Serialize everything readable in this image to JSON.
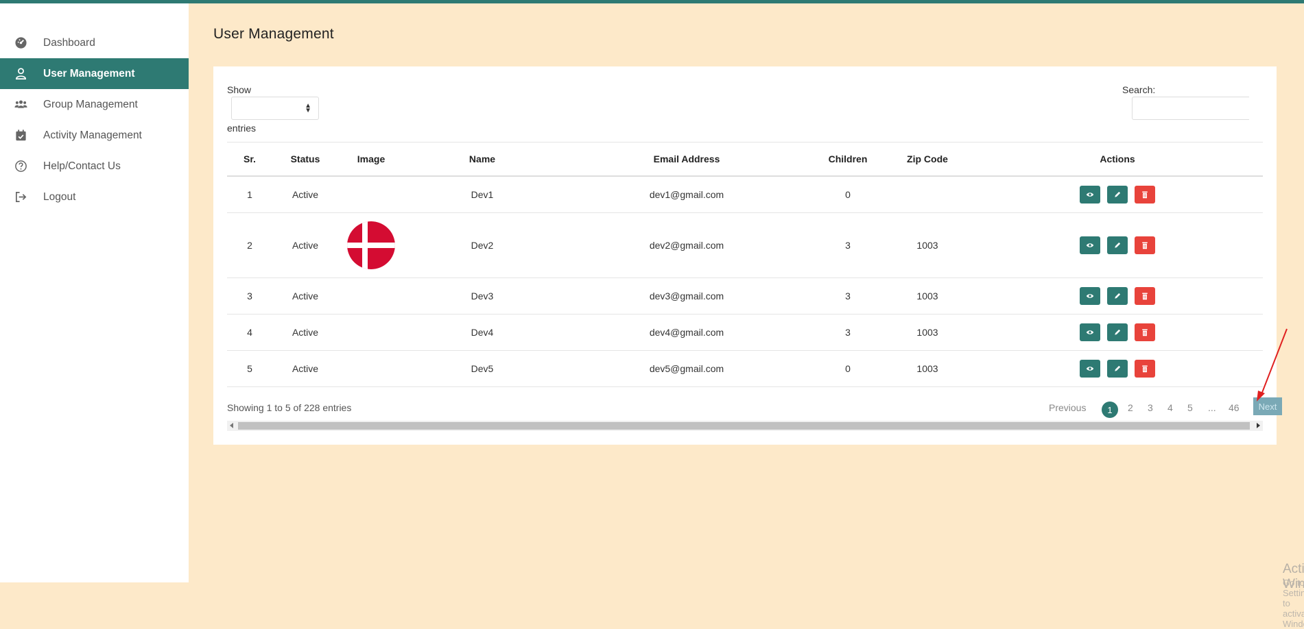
{
  "sidebar": {
    "items": [
      {
        "label": "Dashboard",
        "icon": "dashboard-icon",
        "active": false
      },
      {
        "label": "User Management",
        "icon": "user-icon",
        "active": true
      },
      {
        "label": "Group Management",
        "icon": "users-group-icon",
        "active": false
      },
      {
        "label": "Activity Management",
        "icon": "calendar-check-icon",
        "active": false
      },
      {
        "label": "Help/Contact Us",
        "icon": "help-circle-icon",
        "active": false
      },
      {
        "label": "Logout",
        "icon": "logout-icon",
        "active": false
      }
    ]
  },
  "page": {
    "title": "User Management"
  },
  "controls": {
    "show_label": "Show",
    "entries_label": "entries",
    "search_label": "Search:",
    "length_value": ""
  },
  "table": {
    "headers": [
      "Sr.",
      "Status",
      "Image",
      "Name",
      "Email Address",
      "Children",
      "Zip Code",
      "Actions"
    ],
    "rows": [
      {
        "sr": "1",
        "status": "Active",
        "image": "",
        "name": "Dev1",
        "email": "dev1@gmail.com",
        "children": "0",
        "zip": ""
      },
      {
        "sr": "2",
        "status": "Active",
        "image": "denmark-flag",
        "name": "Dev2",
        "email": "dev2@gmail.com",
        "children": "3",
        "zip": "1003"
      },
      {
        "sr": "3",
        "status": "Active",
        "image": "",
        "name": "Dev3",
        "email": "dev3@gmail.com",
        "children": "3",
        "zip": "1003"
      },
      {
        "sr": "4",
        "status": "Active",
        "image": "",
        "name": "Dev4",
        "email": "dev4@gmail.com",
        "children": "3",
        "zip": "1003"
      },
      {
        "sr": "5",
        "status": "Active",
        "image": "",
        "name": "Dev5",
        "email": "dev5@gmail.com",
        "children": "0",
        "zip": "1003"
      }
    ],
    "action_icons": [
      "eye-icon",
      "pencil-icon",
      "trash-icon"
    ]
  },
  "footer": {
    "info": "Showing 1 to 5 of 228 entries",
    "pagination": {
      "previous": "Previous",
      "current": "1",
      "pages": [
        "2",
        "3",
        "4",
        "5"
      ],
      "ellipsis": "...",
      "last": "46",
      "next": "Next"
    }
  },
  "watermark": {
    "title": "Activate Windows",
    "subtitle": "Go to Settings to activate Windows."
  },
  "colors": {
    "accent": "#2e7a73",
    "danger": "#e8433b",
    "background": "#fde9c9",
    "annotation_arrow": "#e02020"
  }
}
